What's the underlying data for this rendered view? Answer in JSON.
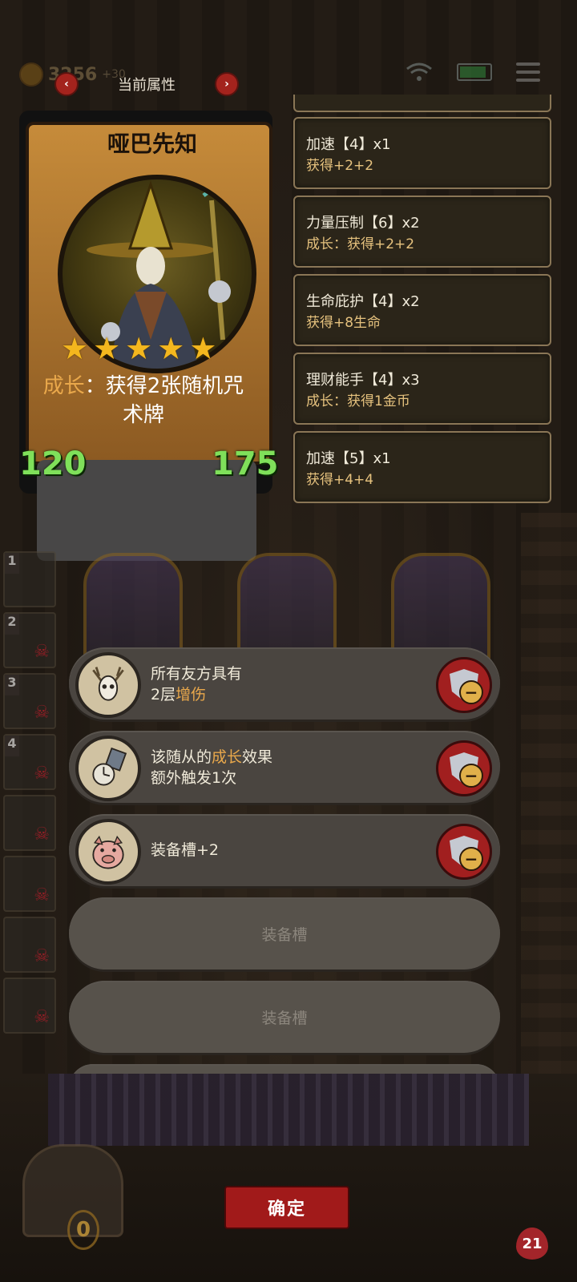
{
  "topbar": {
    "coins": "3256",
    "coins_delta": "+30",
    "title": "当前属性",
    "prev_arrow": "‹",
    "next_arrow": "›"
  },
  "hero": {
    "name": "哑巴先知",
    "stars": 5,
    "desc_keyword": "成长",
    "desc_rest": "：获得2张随机咒术牌",
    "attack": "120",
    "health": "175"
  },
  "buffs": [
    {
      "title": "加速【4】x1",
      "effect": "获得+2+2"
    },
    {
      "title": "力量压制【6】x2",
      "effect": "成长：获得+2+2"
    },
    {
      "title": "生命庇护【4】x2",
      "effect": "获得+8生命"
    },
    {
      "title": "理财能手【4】x3",
      "effect": "成长：获得1金币"
    },
    {
      "title": "加速【5】x1",
      "effect": "获得+4+4"
    }
  ],
  "equipment": [
    {
      "line1": "所有友方具有",
      "line2_prefix": "2层",
      "line2_keyword": "增伤",
      "line2_suffix": "",
      "icon": "deer-skull-icon"
    },
    {
      "line1_prefix": "该随从的",
      "line1_keyword": "成长",
      "line1_suffix": "效果",
      "line2": "额外触发1次",
      "icon": "pocket-watch-icon"
    },
    {
      "line1": "装备槽+2",
      "icon": "pig-icon"
    }
  ],
  "empty_slot_label": "装备槽",
  "side_slots": [
    "1",
    "2",
    "3",
    "4"
  ],
  "confirm_label": "确定",
  "chest_count": "0",
  "bottom_hp": "21",
  "colors": {
    "accent_red": "#a11a1a",
    "keyword": "#e9a84b",
    "stat_green": "#7fe05a"
  }
}
